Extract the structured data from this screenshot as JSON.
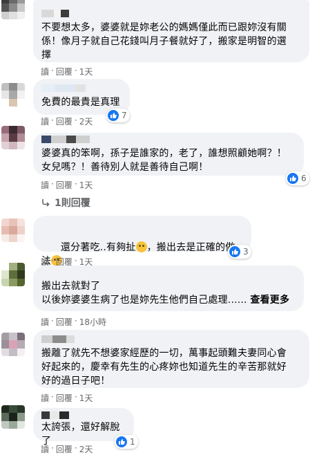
{
  "comments": [
    {
      "text": "不要想太多，婆婆就是妳老公的媽媽僅此而已跟妳沒有關\n係！像月子就自己花錢叫月子餐就好了，搬家是明智的選\n擇",
      "meta": {
        "read": "讀",
        "reply": "回覆",
        "time": "1天"
      }
    },
    {
      "text": "免費的最貴是真理",
      "reactions": "7",
      "meta": {
        "read": "讀",
        "reply": "回覆",
        "time": "2天"
      }
    },
    {
      "text": "婆婆真的笨啊，孫子是誰家的，老了，誰想照顧她啊？！\n女兒嗎？！善待別人就是善待自己啊！",
      "reactions": "6",
      "meta": {
        "read": "讀",
        "reply": "回覆",
        "time": "1天"
      },
      "replies_link": "1則回覆"
    },
    {
      "text_parts": [
        "還分著吃..有夠扯",
        "，搬出去是正確的做法"
      ],
      "reactions": "3",
      "meta": {
        "read": "讀",
        "reply": "回覆",
        "time": "1天"
      }
    },
    {
      "text": "搬出去就對了\n以後妳婆婆生病了也是妳先生他們自己處理......",
      "see_more": "查看更多",
      "meta": {
        "read": "讀",
        "reply": "回覆",
        "time": "18小時"
      }
    },
    {
      "text": "搬離了就先不想婆家經歷的一切，萬事起頭難夫妻同心會\n好起來的，慶幸有先生的心疼妳也知道先生的辛苦那就好\n好的過日子吧！",
      "meta": {
        "read": "讀",
        "reply": "回覆",
        "time": "1天"
      }
    },
    {
      "text": "太誇張，還好解脫了",
      "reactions": "1",
      "meta": {
        "read": "讀",
        "reply": "回覆",
        "time": "2天"
      }
    }
  ],
  "colors": {
    "bubble": "#f0f2f5",
    "meta": "#65676b",
    "like": "#1877f2",
    "emoji": "#f7c33c"
  },
  "icons": [
    "like-icon",
    "reply-arrow-icon",
    "emoji-icon"
  ]
}
